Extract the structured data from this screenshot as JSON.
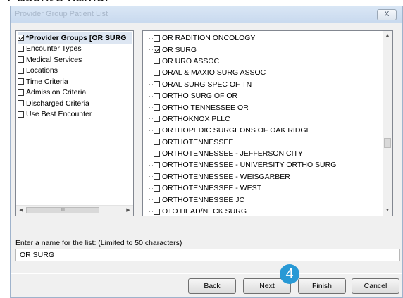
{
  "caption": "Patient's name.",
  "window": {
    "title": "Provider Group Patient List",
    "close_label": "X"
  },
  "criteria": {
    "items": [
      {
        "label": "*Provider Groups [OR SURG",
        "checked": true,
        "selected": true
      },
      {
        "label": "Encounter Types",
        "checked": false,
        "selected": false
      },
      {
        "label": "Medical Services",
        "checked": false,
        "selected": false
      },
      {
        "label": "Locations",
        "checked": false,
        "selected": false
      },
      {
        "label": "Time Criteria",
        "checked": false,
        "selected": false
      },
      {
        "label": "Admission Criteria",
        "checked": false,
        "selected": false
      },
      {
        "label": "Discharged Criteria",
        "checked": false,
        "selected": false
      },
      {
        "label": "Use Best Encounter",
        "checked": false,
        "selected": false
      }
    ],
    "scroll_thumb_label": "III"
  },
  "groups": {
    "items": [
      {
        "label": "OR RADITION ONCOLOGY",
        "checked": false
      },
      {
        "label": "OR SURG",
        "checked": true
      },
      {
        "label": "OR URO ASSOC",
        "checked": false
      },
      {
        "label": "ORAL & MAXIO SURG ASSOC",
        "checked": false
      },
      {
        "label": "ORAL SURG SPEC OF TN",
        "checked": false
      },
      {
        "label": "ORTHO SURG OF OR",
        "checked": false
      },
      {
        "label": "ORTHO TENNESSEE OR",
        "checked": false
      },
      {
        "label": "ORTHOKNOX PLLC",
        "checked": false
      },
      {
        "label": "ORTHOPEDIC SURGEONS OF OAK RIDGE",
        "checked": false
      },
      {
        "label": "ORTHOTENNESSEE",
        "checked": false
      },
      {
        "label": "ORTHOTENNESSEE - JEFFERSON CITY",
        "checked": false
      },
      {
        "label": "ORTHOTENNESSEE - UNIVERSITY ORTHO SURG",
        "checked": false
      },
      {
        "label": "ORTHOTENNESSEE - WEISGARBER",
        "checked": false
      },
      {
        "label": "ORTHOTENNESSEE - WEST",
        "checked": false
      },
      {
        "label": "ORTHOTENNESSEE JC",
        "checked": false
      },
      {
        "label": "OTO HEAD/NECK SURG",
        "checked": false
      }
    ]
  },
  "name_field": {
    "label": "Enter a name for the list: (Limited to 50 characters)",
    "value": "OR SURG"
  },
  "buttons": {
    "back": "Back",
    "next": "Next",
    "finish": "Finish",
    "cancel": "Cancel"
  },
  "step_badge": "4"
}
